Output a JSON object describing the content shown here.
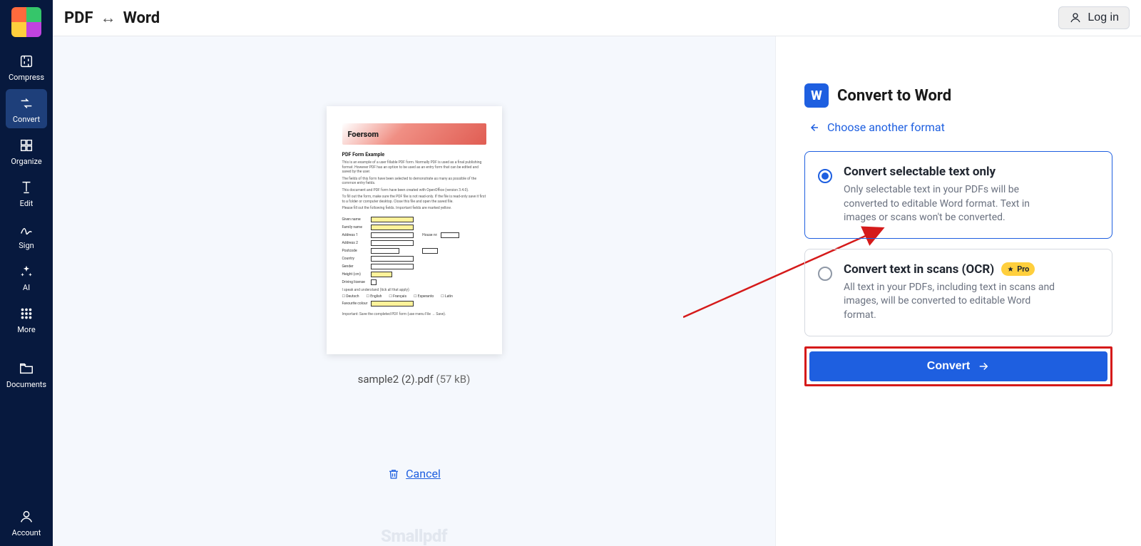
{
  "header": {
    "title_left": "PDF",
    "title_right": "Word",
    "login_label": "Log in"
  },
  "sidebar": {
    "items": [
      {
        "label": "Compress"
      },
      {
        "label": "Convert"
      },
      {
        "label": "Organize"
      },
      {
        "label": "Edit"
      },
      {
        "label": "Sign"
      },
      {
        "label": "AI"
      },
      {
        "label": "More"
      }
    ],
    "documents_label": "Documents",
    "account_label": "Account"
  },
  "preview": {
    "thumb_brand": "Foersom",
    "thumb_heading": "PDF Form Example",
    "file_name": "sample2 (2).pdf",
    "file_size": "(57 kB)",
    "cancel_label": "Cancel",
    "watermark": "Smallpdf"
  },
  "options": {
    "panel_title": "Convert to Word",
    "choose_other": "Choose another format",
    "choices": [
      {
        "title": "Convert selectable text only",
        "desc": "Only selectable text in your PDFs will be converted to editable Word format. Text in images or scans won't be converted."
      },
      {
        "title": "Convert text in scans (OCR)",
        "pro": "Pro",
        "desc": "All text in your PDFs, including text in scans and images, will be converted to editable Word format."
      }
    ],
    "convert_label": "Convert"
  }
}
